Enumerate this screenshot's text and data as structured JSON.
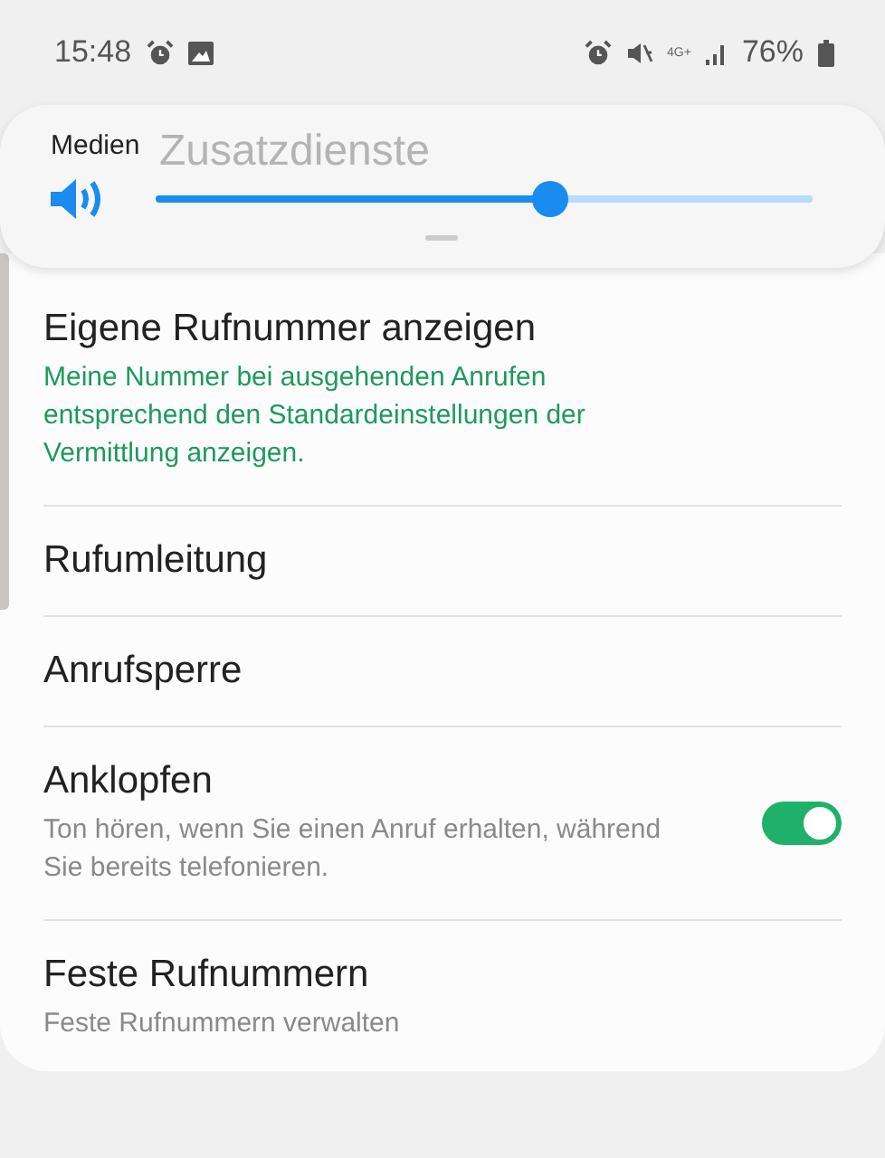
{
  "status_bar": {
    "time": "15:48",
    "network_type": "4G+",
    "battery": "76%"
  },
  "volume_panel": {
    "label": "Medien",
    "level": 0.6
  },
  "screen_title": "Zusatzdienste",
  "settings": [
    {
      "kind": "plain",
      "title": "Eigene Rufnummer anzeigen",
      "summary": "Meine Nummer bei ausgehenden Anrufen entsprechend den Standardeinstellungen der Vermittlung anzeigen.",
      "summary_highlighted": true
    },
    {
      "kind": "plain",
      "title": "Rufumleitung"
    },
    {
      "kind": "plain",
      "title": "Anrufsperre"
    },
    {
      "kind": "toggle",
      "title": "Anklopfen",
      "summary": "Ton hören, wenn Sie einen Anruf erhalten, während Sie bereits telefonieren.",
      "summary_highlighted": false,
      "on": true
    },
    {
      "kind": "plain",
      "title": "Feste Rufnummern",
      "summary": "Feste Rufnummern verwalten",
      "summary_highlighted": false
    }
  ]
}
